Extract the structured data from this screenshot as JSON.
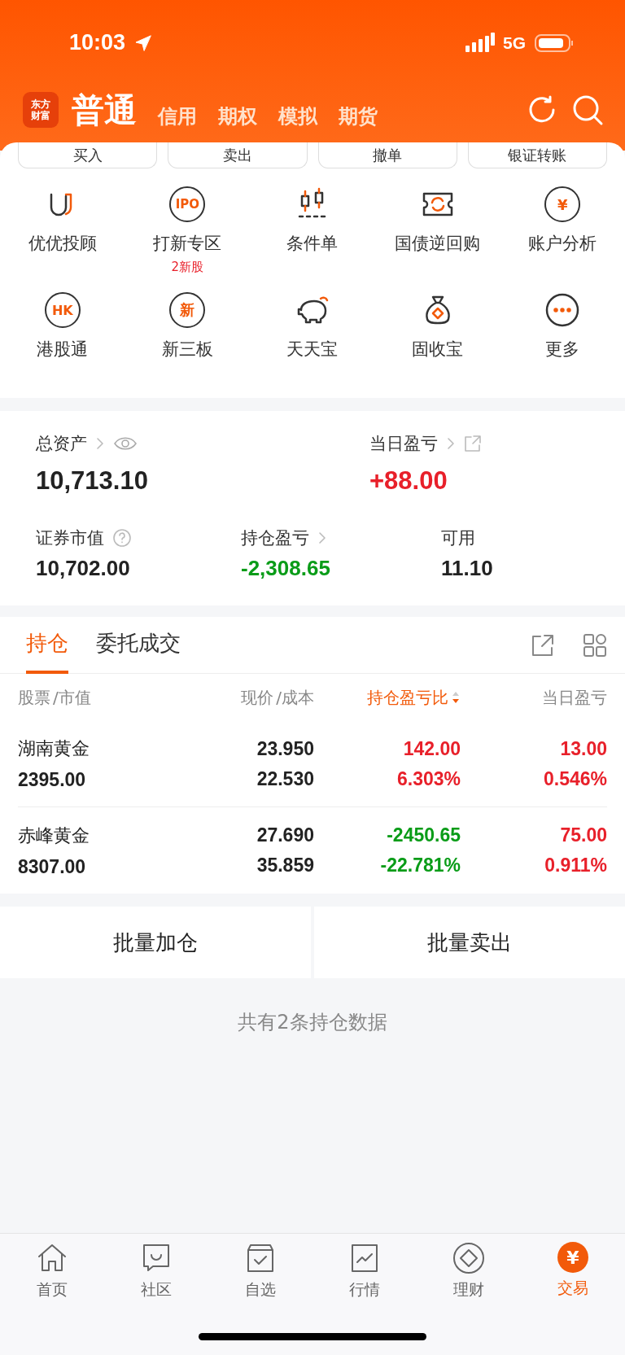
{
  "status_bar": {
    "time": "10:03",
    "network": "5G"
  },
  "header": {
    "logo": [
      "东方",
      "财富"
    ],
    "tabs": [
      {
        "label": "普通",
        "selected": true
      },
      {
        "label": "信用",
        "selected": false
      },
      {
        "label": "期权",
        "selected": false
      },
      {
        "label": "模拟",
        "selected": false
      },
      {
        "label": "期货",
        "selected": false
      }
    ]
  },
  "actions": [
    "买入",
    "卖出",
    "撤单",
    "银证转账"
  ],
  "shortcuts": [
    {
      "label": "优优投顾"
    },
    {
      "label": "打新专区",
      "icon_text": "IPO",
      "note": "2新股"
    },
    {
      "label": "条件单"
    },
    {
      "label": "国债逆回购"
    },
    {
      "label": "账户分析",
      "icon_text": "¥"
    },
    {
      "label": "港股通",
      "icon_text": "HK"
    },
    {
      "label": "新三板",
      "icon_text": "新"
    },
    {
      "label": "天天宝"
    },
    {
      "label": "固收宝"
    },
    {
      "label": "更多"
    }
  ],
  "assets": {
    "total": {
      "label": "总资产",
      "value": "10,713.10",
      "color": "#222222"
    },
    "today_pnl": {
      "label": "当日盈亏",
      "value": "+88.00",
      "color": "#e8202a"
    },
    "stats": [
      {
        "label": "证券市值",
        "value": "10,702.00",
        "color": "#222222"
      },
      {
        "label": "持仓盈亏",
        "value": "-2,308.65",
        "color": "#0a9c18"
      },
      {
        "label": "可用",
        "value": "11.10",
        "color": "#222222"
      }
    ]
  },
  "positions_tabs": [
    {
      "label": "持仓",
      "selected": true
    },
    {
      "label": "委托成交",
      "selected": false
    }
  ],
  "table": {
    "columns": [
      {
        "label": "股票",
        "sub": "/市值",
        "sorted": false
      },
      {
        "label": "现价",
        "sub": "/成本",
        "sorted": false
      },
      {
        "label": "持仓盈亏比",
        "sorted": true
      },
      {
        "label": "当日盈亏",
        "sorted": false
      }
    ],
    "rows": [
      {
        "name": "湖南黄金",
        "market_value": "2395.00",
        "price": "23.950",
        "cost": "22.530",
        "pnl": {
          "value": "142.00",
          "color": "#e8202a"
        },
        "pnl_pct": {
          "value": "6.303%",
          "color": "#e8202a"
        },
        "day_pnl": {
          "value": "13.00",
          "color": "#e8202a"
        },
        "day_pct": {
          "value": "0.546%",
          "color": "#e8202a"
        }
      },
      {
        "name": "赤峰黄金",
        "market_value": "8307.00",
        "price": "27.690",
        "cost": "35.859",
        "pnl": {
          "value": "-2450.65",
          "color": "#0a9c18"
        },
        "pnl_pct": {
          "value": "-22.781%",
          "color": "#0a9c18"
        },
        "day_pnl": {
          "value": "75.00",
          "color": "#e8202a"
        },
        "day_pct": {
          "value": "0.911%",
          "color": "#e8202a"
        }
      }
    ]
  },
  "batch_buttons": [
    "批量加仓",
    "批量卖出"
  ],
  "summary": "共有2条持仓数据",
  "tab_bar": [
    {
      "label": "首页",
      "selected": false
    },
    {
      "label": "社区",
      "selected": false
    },
    {
      "label": "自选",
      "selected": false
    },
    {
      "label": "行情",
      "selected": false
    },
    {
      "label": "理财",
      "selected": false
    },
    {
      "label": "交易",
      "selected": true,
      "icon_text": "¥"
    }
  ]
}
